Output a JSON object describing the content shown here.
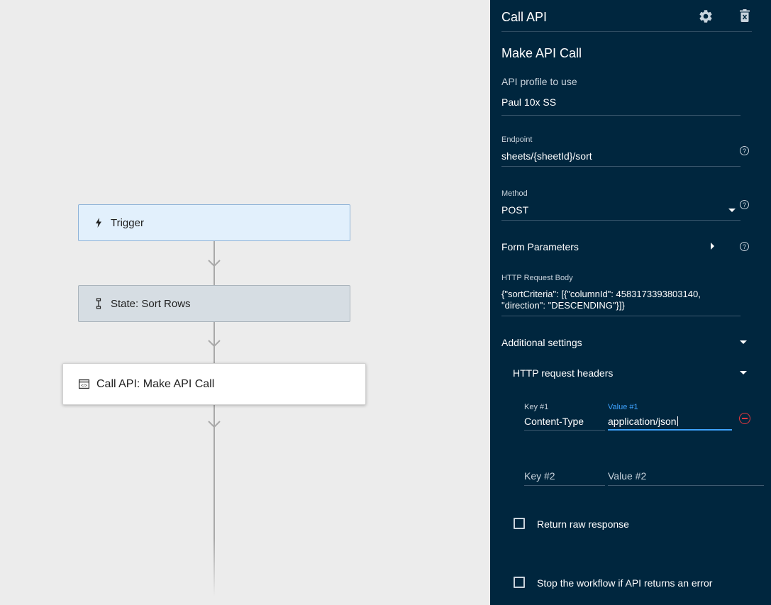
{
  "canvas": {
    "nodes": {
      "trigger": {
        "label": "Trigger",
        "icon": "lightning-icon"
      },
      "state": {
        "label": "State: Sort Rows",
        "icon": "state-icon"
      },
      "call_api": {
        "label": "Call API: Make API Call",
        "icon": "api-window-icon"
      }
    }
  },
  "panel": {
    "title": "Call API",
    "subtitle": "Make API Call",
    "api_profile": {
      "label": "API profile to use",
      "value": "Paul 10x SS"
    },
    "endpoint": {
      "label": "Endpoint",
      "value": "sheets/{sheetId}/sort"
    },
    "method": {
      "label": "Method",
      "value": "POST"
    },
    "form_parameters": {
      "label": "Form Parameters"
    },
    "http_body": {
      "label": "HTTP Request Body",
      "value": "{\"sortCriteria\": [{\"columnId\": 4583173393803140, \"direction\": \"DESCENDING\"}]}"
    },
    "additional_settings": {
      "label": "Additional settings"
    },
    "headers": {
      "label": "HTTP request headers",
      "key1": {
        "label": "Key #1",
        "value": "Content-Type"
      },
      "value1": {
        "label": "Value #1",
        "value": "application/json"
      },
      "key2": {
        "placeholder": "Key #2"
      },
      "value2": {
        "placeholder": "Value #2"
      }
    },
    "return_raw": {
      "label": "Return raw response",
      "checked": false
    },
    "stop_on_error": {
      "label": "Stop the workflow if API returns an error",
      "checked": false
    },
    "help_glyph": "?"
  },
  "colors": {
    "panel_bg": "#00263e",
    "canvas_bg": "#ececec",
    "focus_accent": "#3ea3ff",
    "remove_red": "#e0393e",
    "trigger_bg": "#e2f0fc",
    "state_bg": "#d6dde3"
  }
}
